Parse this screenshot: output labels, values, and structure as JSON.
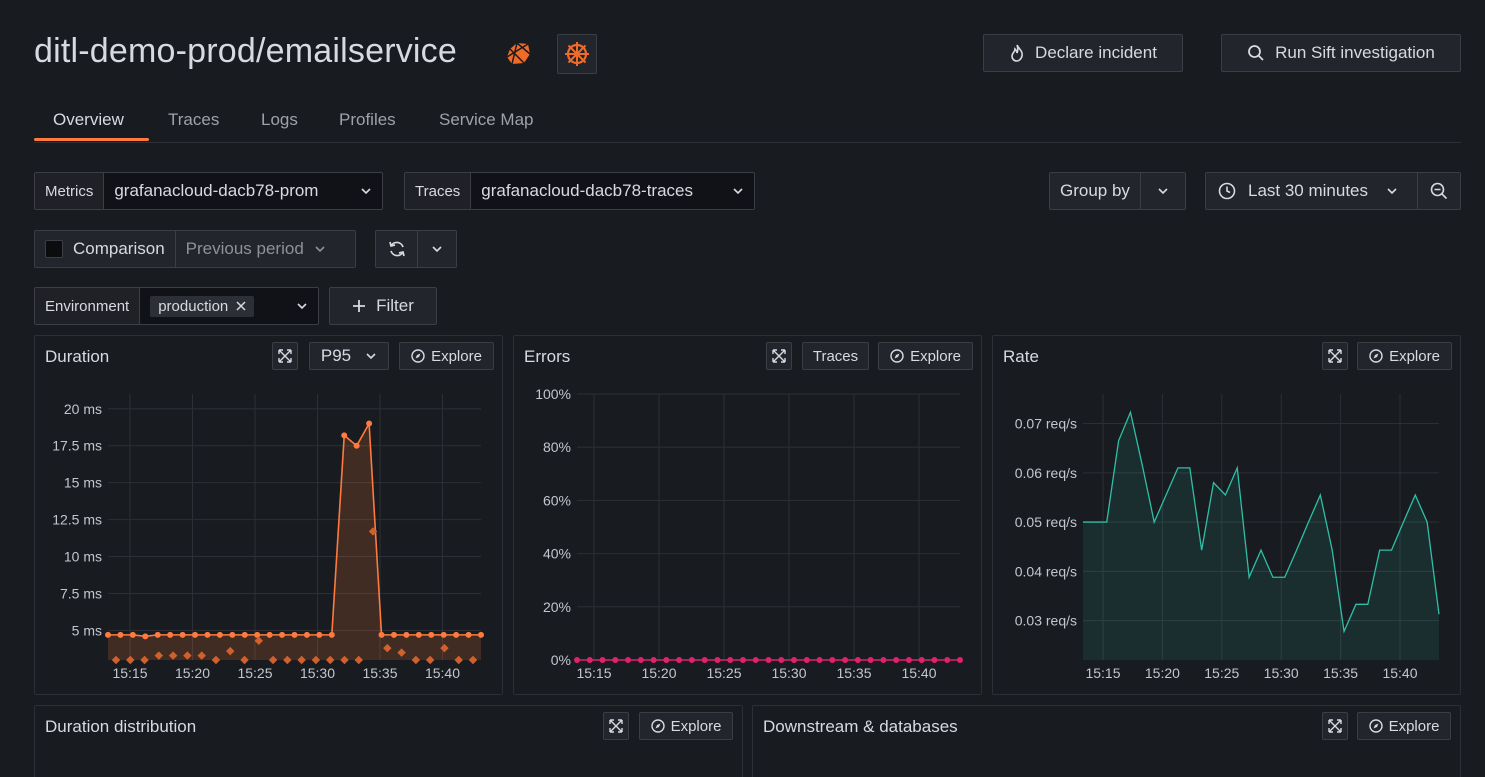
{
  "header": {
    "title": "ditl-demo-prod/emailservice",
    "declare_incident": "Declare incident",
    "run_sift": "Run Sift investigation"
  },
  "tabs": [
    {
      "label": "Overview",
      "active": true
    },
    {
      "label": "Traces"
    },
    {
      "label": "Logs"
    },
    {
      "label": "Profiles"
    },
    {
      "label": "Service Map"
    }
  ],
  "controls": {
    "metrics_label": "Metrics",
    "metrics_value": "grafanacloud-dacb78-prom",
    "traces_label": "Traces",
    "traces_value": "grafanacloud-dacb78-traces",
    "group_by": "Group by",
    "time_range": "Last 30 minutes",
    "comparison_label": "Comparison",
    "comparison_value": "Previous period",
    "comparison_checked": false,
    "environment_label": "Environment",
    "environment_chip": "production",
    "filter_label": "Filter"
  },
  "panels": {
    "duration": {
      "title": "Duration",
      "stat": "P95",
      "explore": "Explore"
    },
    "errors": {
      "title": "Errors",
      "traces": "Traces",
      "explore": "Explore"
    },
    "rate": {
      "title": "Rate",
      "explore": "Explore"
    },
    "duration_distribution": {
      "title": "Duration distribution",
      "explore": "Explore"
    },
    "downstream": {
      "title": "Downstream & databases",
      "explore": "Explore"
    }
  },
  "colors": {
    "accent": "#ff7a3c",
    "errors_series": "#e0226e",
    "rate_series": "#2fbfa6"
  },
  "chart_data": [
    {
      "type": "line",
      "name": "duration",
      "x": [
        "15:15",
        "15:20",
        "15:25",
        "15:30",
        "15:35",
        "15:40"
      ],
      "y_ticks": [
        "20 ms",
        "17.5 ms",
        "15 ms",
        "12.5 ms",
        "10 ms",
        "7.5 ms",
        "5 ms"
      ],
      "ylim": [
        3,
        21
      ],
      "series": [
        {
          "values": [
            4.7,
            4.7,
            4.7,
            4.6,
            4.7,
            4.7,
            4.7,
            4.7,
            4.7,
            4.7,
            4.7,
            4.7,
            4.7,
            4.7,
            4.7,
            4.7,
            4.7,
            4.7,
            4.7,
            18.2,
            17.5,
            19.0,
            4.7,
            4.7,
            4.7,
            4.7,
            4.7,
            4.7,
            4.7,
            4.7,
            4.7
          ]
        }
      ],
      "scatter": [
        3.0,
        3.0,
        3.0,
        3.3,
        3.3,
        3.3,
        3.3,
        3.0,
        3.6,
        3.0,
        4.3,
        3.0,
        3.0,
        3.0,
        3.0,
        3.0,
        3.0,
        3.0,
        11.7,
        3.8,
        3.5,
        3.0,
        3.0,
        3.8,
        3.0,
        3.0
      ]
    },
    {
      "type": "line",
      "name": "errors",
      "x": [
        "15:15",
        "15:20",
        "15:25",
        "15:30",
        "15:35",
        "15:40"
      ],
      "y_ticks": [
        "100%",
        "80%",
        "60%",
        "40%",
        "20%",
        "0%"
      ],
      "ylim": [
        0,
        100
      ],
      "series": [
        {
          "values": [
            0,
            0,
            0,
            0,
            0,
            0,
            0,
            0,
            0,
            0,
            0,
            0,
            0,
            0,
            0,
            0,
            0,
            0,
            0,
            0,
            0,
            0,
            0,
            0,
            0,
            0,
            0,
            0,
            0,
            0,
            0
          ]
        }
      ]
    },
    {
      "type": "area",
      "name": "rate",
      "x": [
        "15:15",
        "15:20",
        "15:25",
        "15:30",
        "15:35",
        "15:40"
      ],
      "y_ticks": [
        "0.07 req/s",
        "0.06 req/s",
        "0.05 req/s",
        "0.04 req/s",
        "0.03 req/s"
      ],
      "ylim": [
        0.022,
        0.076
      ],
      "series": [
        {
          "values": [
            0.05,
            0.05,
            0.05,
            0.0665,
            0.0723,
            0.0615,
            0.05,
            0.0555,
            0.061,
            0.061,
            0.0443,
            0.058,
            0.0555,
            0.061,
            0.0388,
            0.0443,
            0.0388,
            0.0388,
            0.0443,
            0.05,
            0.0555,
            0.0443,
            0.0278,
            0.0333,
            0.0333,
            0.0443,
            0.0443,
            0.05,
            0.0555,
            0.05,
            0.0313
          ]
        }
      ]
    }
  ]
}
